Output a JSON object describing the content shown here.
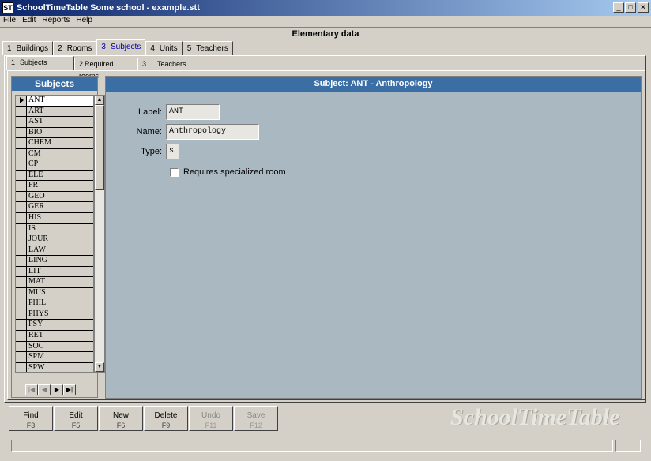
{
  "window": {
    "title": "SchoolTimeTable Some school - example.stt",
    "icon_text": "ST",
    "minimize_glyph": "_",
    "maximize_glyph": "□",
    "close_glyph": "✕"
  },
  "menu": [
    "File",
    "Edit",
    "Reports",
    "Help"
  ],
  "section_title": "Elementary data",
  "main_tabs": [
    {
      "num": "1",
      "label": "Buildings"
    },
    {
      "num": "2",
      "label": "Rooms"
    },
    {
      "num": "3",
      "label": "Subjects"
    },
    {
      "num": "4",
      "label": "Units"
    },
    {
      "num": "5",
      "label": "Teachers"
    }
  ],
  "sub_tabs": [
    {
      "num": "1",
      "label": "Subjects"
    },
    {
      "num": "2",
      "label": "Required rooms"
    },
    {
      "num": "3",
      "label": "Teachers"
    }
  ],
  "list": {
    "header": "Subjects",
    "items": [
      "ANT",
      "ART",
      "AST",
      "BIO",
      "CHEM",
      "CM",
      "CP",
      "ELE",
      "FR",
      "GEO",
      "GER",
      "HIS",
      "IS",
      "JOUR",
      "LAW",
      "LING",
      "LIT",
      "MAT",
      "MUS",
      "PHIL",
      "PHYS",
      "PSY",
      "RET",
      "SOC",
      "SPM",
      "SPW"
    ],
    "nav": {
      "first": "|◀",
      "prev": "◀",
      "next": "▶",
      "last": "▶|"
    },
    "scroll_up": "▲",
    "scroll_down": "▼"
  },
  "detail": {
    "header": "Subject:  ANT - Anthropology",
    "label_caption": "Label:",
    "label_value": "ANT",
    "name_caption": "Name:",
    "name_value": "Anthropology",
    "type_caption": "Type:",
    "type_value": "s",
    "requires_room_label": "Requires specialized room"
  },
  "toolbar": [
    {
      "label": "Find",
      "key": "F3"
    },
    {
      "label": "Edit",
      "key": "F5"
    },
    {
      "label": "New",
      "key": "F6"
    },
    {
      "label": "Delete",
      "key": "F9"
    },
    {
      "label": "Undo",
      "key": "F11"
    },
    {
      "label": "Save",
      "key": "F12"
    }
  ],
  "brand": "SchoolTimeTable"
}
